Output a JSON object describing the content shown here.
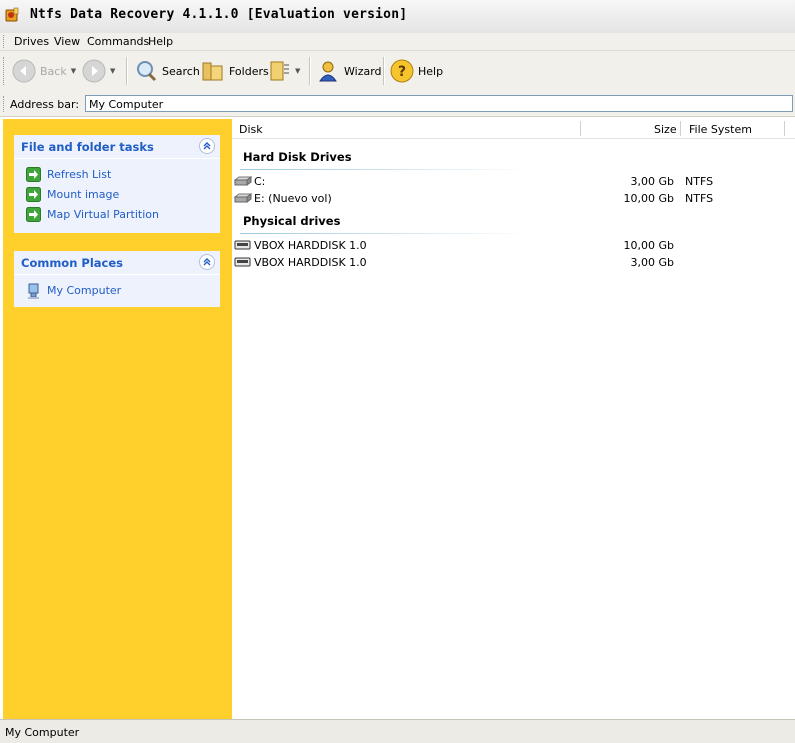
{
  "window": {
    "title": "Ntfs Data Recovery 4.1.1.0 [Evaluation version]"
  },
  "menu": {
    "items": [
      "Drives",
      "View",
      "Commands",
      "Help"
    ]
  },
  "toolbar": {
    "back_label": "Back",
    "search_label": "Search",
    "folders_label": "Folders",
    "wizard_label": "Wizard",
    "help_label": "Help"
  },
  "address": {
    "label": "Address bar:",
    "value": "My Computer"
  },
  "sidebar": {
    "tasks_title": "File and folder tasks",
    "tasks": [
      "Refresh List",
      "Mount image",
      "Map Virtual Partition"
    ],
    "places_title": "Common Places",
    "places": [
      "My Computer"
    ]
  },
  "columns": {
    "disk": "Disk",
    "size": "Size",
    "file_system": "File System"
  },
  "groups": [
    {
      "title": "Hard Disk Drives",
      "rows": [
        {
          "name": "C:",
          "size": "3,00 Gb",
          "fs": "NTFS",
          "icon": "hard-disk-icon"
        },
        {
          "name": "E: (Nuevo vol)",
          "size": "10,00 Gb",
          "fs": "NTFS",
          "icon": "hard-disk-icon"
        }
      ]
    },
    {
      "title": "Physical drives",
      "rows": [
        {
          "name": "VBOX HARDDISK 1.0",
          "size": "10,00 Gb",
          "fs": "",
          "icon": "physical-drive-icon"
        },
        {
          "name": "VBOX HARDDISK 1.0",
          "size": "3,00 Gb",
          "fs": "",
          "icon": "physical-drive-icon"
        }
      ]
    }
  ],
  "status": {
    "text": "My Computer"
  },
  "colors": {
    "sidebar_bg": "#ffd02b",
    "task_link": "#215dc6",
    "panel_bg": "#eef2fc"
  }
}
